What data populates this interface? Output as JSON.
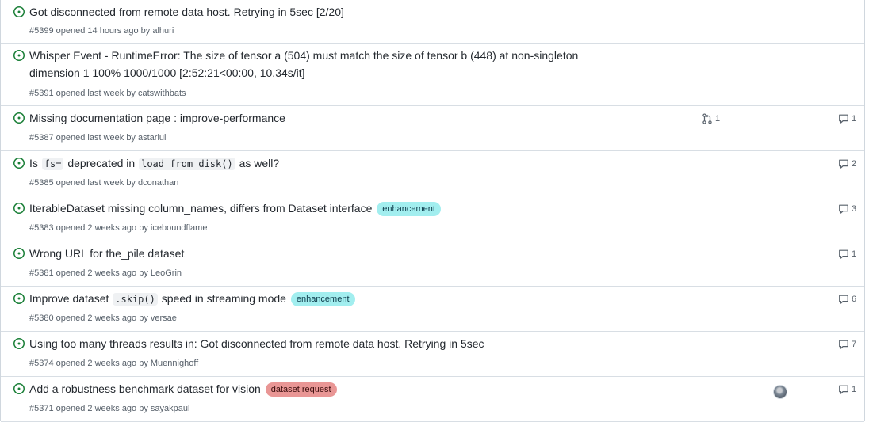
{
  "issues": [
    {
      "title": "Got disconnected from remote data host. Retrying in 5sec [2/20]",
      "meta": "#5399 opened 14 hours ago by alhuri",
      "comments": ""
    },
    {
      "title_line1": "Whisper Event - RuntimeError: The size of tensor a (504) must match the size of tensor b (448) at non-singleton",
      "title_line2": "dimension 1 100% 1000/1000 [2:52:21<00:00, 10.34s/it]",
      "meta": "#5391 opened last week by catswithbats",
      "comments": ""
    },
    {
      "title": "Missing documentation page : improve-performance",
      "meta": "#5387 opened last week by astariul",
      "pr_count": "1",
      "comments": "1"
    },
    {
      "title_pre": "Is",
      "code1": "fs=",
      "title_mid": "deprecated in",
      "code2": "load_from_disk()",
      "title_post": "as well?",
      "meta": "#5385 opened last week by dconathan",
      "comments": "2"
    },
    {
      "title": "IterableDataset missing column_names, differs from Dataset interface",
      "label": "enhancement",
      "meta": "#5383 opened 2 weeks ago by iceboundflame",
      "comments": "3"
    },
    {
      "title": "Wrong URL for the_pile dataset",
      "meta": "#5381 opened 2 weeks ago by LeoGrin",
      "comments": "1"
    },
    {
      "title_pre": "Improve dataset",
      "code1": ".skip()",
      "title_post": "speed in streaming mode",
      "label": "enhancement",
      "meta": "#5380 opened 2 weeks ago by versae",
      "comments": "6"
    },
    {
      "title": "Using too many threads results in: Got disconnected from remote data host. Retrying in 5sec",
      "meta": "#5374 opened 2 weeks ago by Muennighoff",
      "comments": "7"
    },
    {
      "title": "Add a robustness benchmark dataset for vision",
      "label": "dataset request",
      "meta": "#5371 opened 2 weeks ago by sayakpaul",
      "comments": "1"
    }
  ],
  "colors": {
    "open_icon": "#1a7f37",
    "label_enhancement": "#a2eeef",
    "label_dataset_request": "#e99695"
  },
  "icons": {
    "status": "issue-opened-icon",
    "comment": "comment-icon",
    "pr": "git-pull-request-icon"
  }
}
